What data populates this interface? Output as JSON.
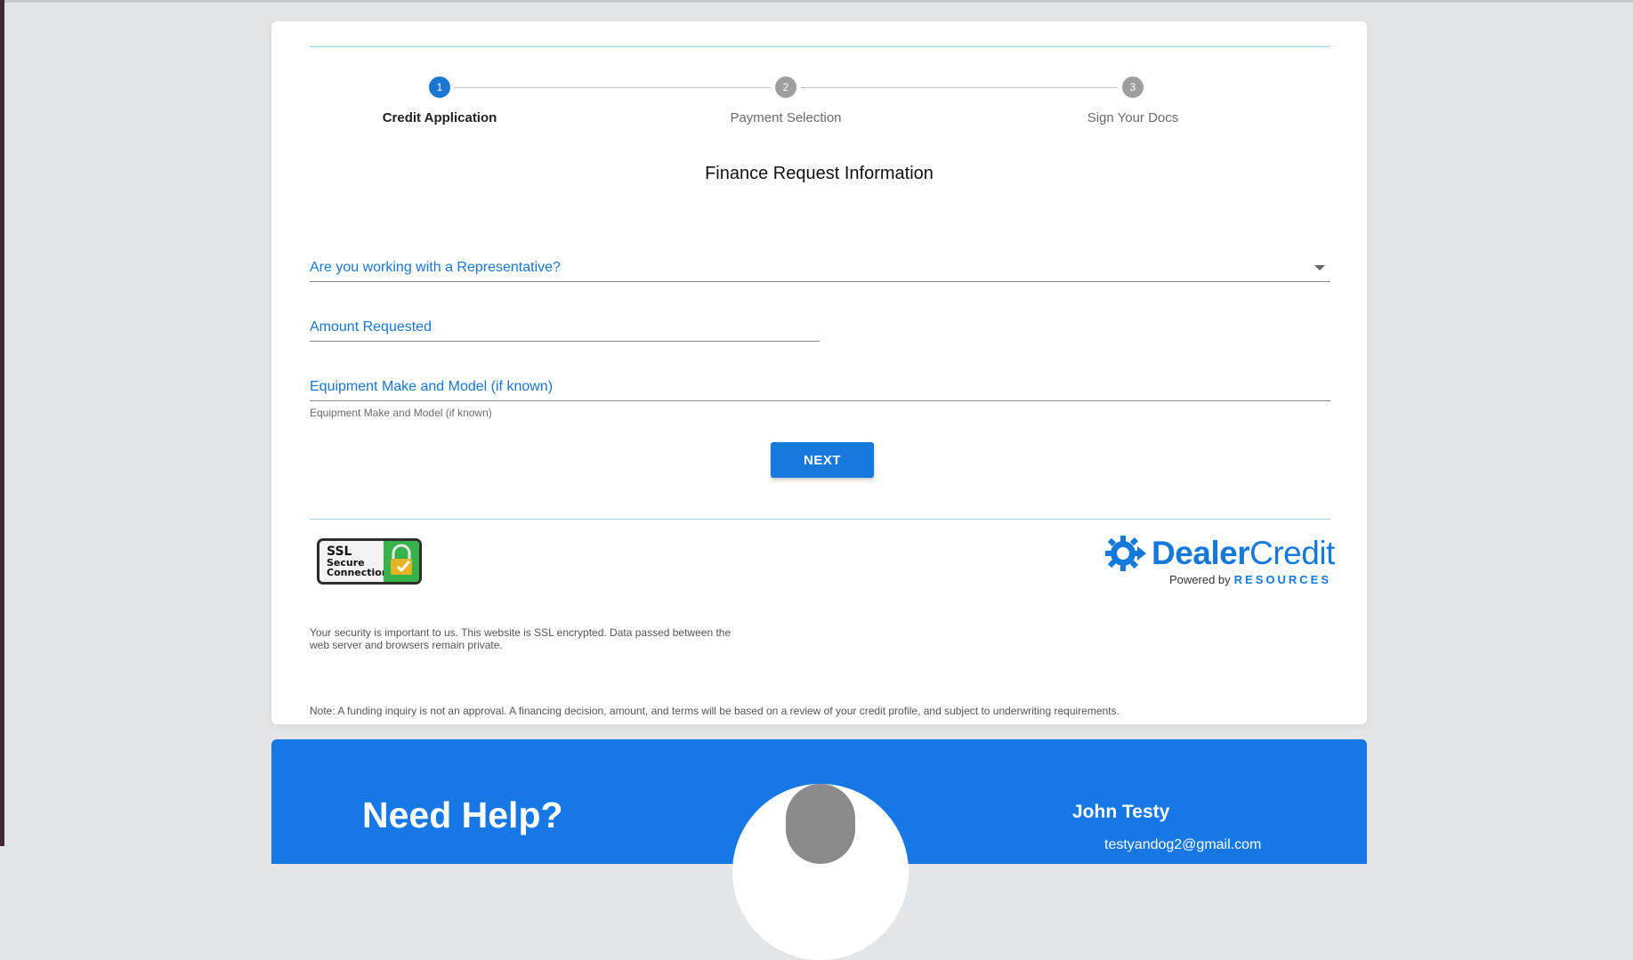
{
  "stepper": {
    "steps": [
      {
        "number": "1",
        "label": "Credit Application",
        "state": "active"
      },
      {
        "number": "2",
        "label": "Payment Selection",
        "state": "inactive"
      },
      {
        "number": "3",
        "label": "Sign Your Docs",
        "state": "inactive"
      }
    ]
  },
  "form": {
    "title": "Finance Request Information",
    "representative_label": "Are you working with a Representative?",
    "amount_label": "Amount Requested",
    "equipment_label": "Equipment Make and Model (if known)",
    "equipment_helper": "Equipment Make and Model (if known)",
    "next_label": "NEXT"
  },
  "security": {
    "badge_line1": "SSL",
    "badge_line2": "Secure",
    "badge_line3": "Connection",
    "text": "Your security is important to us. This website is SSL encrypted. Data passed between the web server and browsers remain private."
  },
  "logo": {
    "name_part1": "Dealer",
    "name_part2": "Credit",
    "powered_by": "Powered by",
    "resources": "RESOURCES",
    "icon": "gear-icon"
  },
  "note": "Note: A funding inquiry is not an approval. A financing decision, amount, and terms will be based on a review of your credit profile, and subject to underwriting requirements.",
  "help": {
    "title": "Need Help?",
    "rep_name": "John Testy",
    "rep_email": "testyandog2@gmail.com"
  },
  "colors": {
    "accent": "#1578db",
    "help_panel": "#1578e5",
    "divider": "#9fd0ee"
  }
}
